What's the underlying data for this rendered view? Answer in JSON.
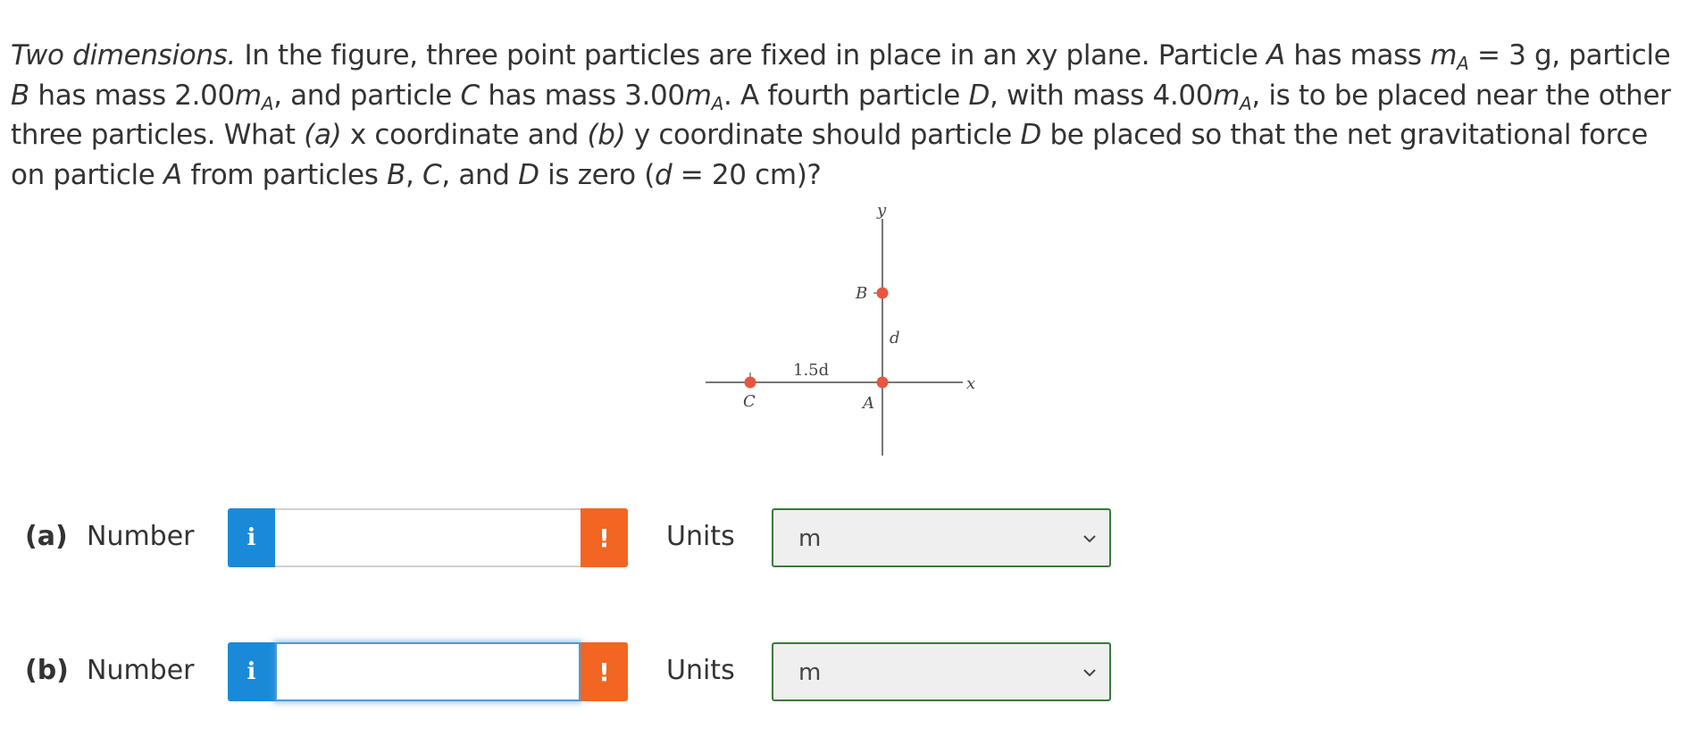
{
  "problem": {
    "title": "Two dimensions.",
    "s1": " In the figure, three point particles are fixed in place in an xy plane. Particle ",
    "A1": "A",
    "s2": " has mass ",
    "m1": "m",
    "sub1": "A",
    "s3": " = 3 g, particle ",
    "B1": "B",
    "s4": " has mass 2.00",
    "m2": "m",
    "sub2": "A",
    "s5": ", and particle ",
    "C1": "C",
    "s6": " has mass 3.00",
    "m3": "m",
    "sub3": "A",
    "s7": ". A fourth particle ",
    "D1": "D",
    "s8": ", with mass 4.00",
    "m4": "m",
    "sub4": "A",
    "s9": ", is to be placed near the other three particles. What ",
    "pa": "(a)",
    "s10": " x coordinate and ",
    "pb": "(b)",
    "s11": " y coordinate should particle ",
    "D2": "D",
    "s12": " be placed so that the net gravitational force on particle ",
    "A2": "A",
    "s13": " from particles ",
    "B2": "B",
    "s14": ", ",
    "C2": "C",
    "s15": ", and ",
    "D3": "D",
    "s16": " is zero (",
    "d1": "d",
    "s17": " = 20 cm)?"
  },
  "figure": {
    "y_axis": "y",
    "x_axis": "x",
    "label_B": "B",
    "label_d": "d",
    "label_15d": "1.5d",
    "label_C": "C",
    "label_A": "A",
    "particle_color": "#e8563f"
  },
  "rows": [
    {
      "part": "(a)",
      "number_label": "Number",
      "info_icon": "i",
      "input_value": "",
      "alert_icon": "!",
      "units_label": "Units",
      "units_value": "m"
    },
    {
      "part": "(b)",
      "number_label": "Number",
      "info_icon": "i",
      "input_value": "",
      "alert_icon": "!",
      "units_label": "Units",
      "units_value": "m"
    }
  ],
  "colors": {
    "info": "#1a8ad8",
    "alert": "#f26522",
    "select_border": "#3b7a3b",
    "select_bg": "#efefef",
    "focus": "#4a9bd8"
  }
}
